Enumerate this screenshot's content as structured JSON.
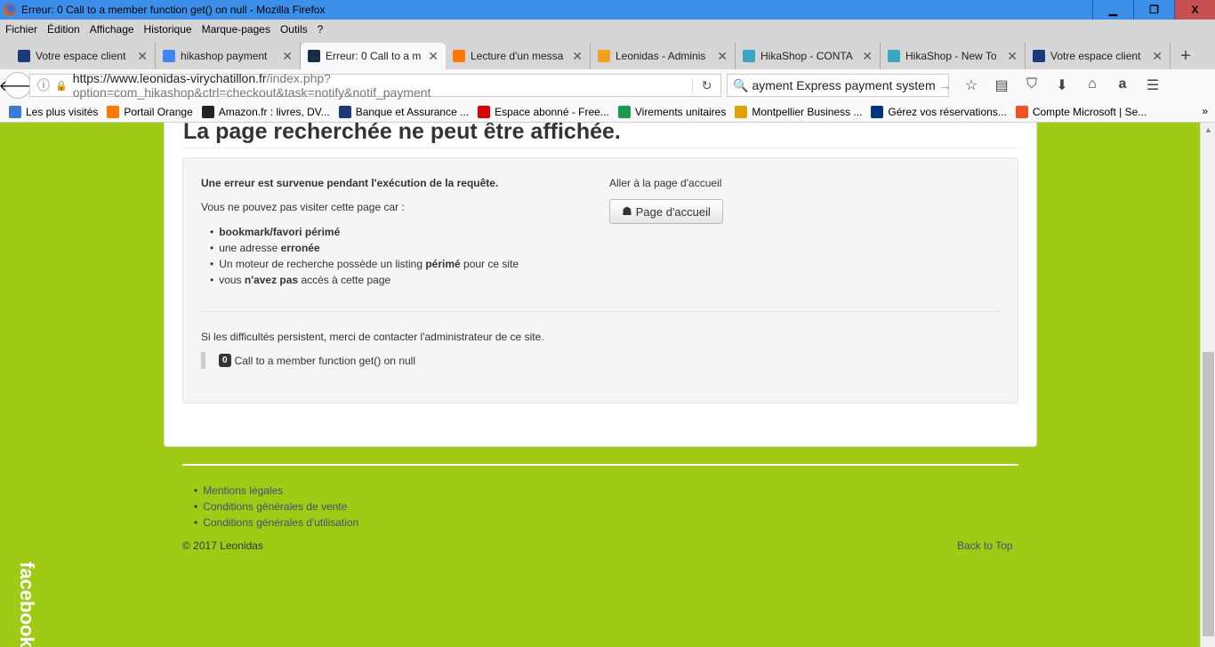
{
  "window": {
    "title": "Erreur: 0 Call to a member function get() on null - Mozilla Firefox",
    "min": "▁",
    "restore": "❐",
    "close": "X"
  },
  "menu": [
    "Fichier",
    "Édition",
    "Affichage",
    "Historique",
    "Marque-pages",
    "Outils",
    "?"
  ],
  "tabs": [
    {
      "label": "Votre espace client",
      "color": "#1a3a7a"
    },
    {
      "label": "hikashop payment",
      "color": "#4285f4"
    },
    {
      "label": "Erreur: 0 Call to a m",
      "color": "#1c2a4a",
      "active": true
    },
    {
      "label": "Lecture d'un messa",
      "color": "#ff7900"
    },
    {
      "label": "Leonidas - Adminis",
      "color": "#f4a020"
    },
    {
      "label": "HikaShop - CONTA",
      "color": "#3aa6c0"
    },
    {
      "label": "HikaShop - New To",
      "color": "#3aa6c0"
    },
    {
      "label": "Votre espace client",
      "color": "#1a3a7a"
    }
  ],
  "new_tab": "+",
  "address": {
    "domain": "https://www.leonidas-virychatillon.fr",
    "path": "/index.php?option=com_hikashop&ctrl=checkout&task=notify&notif_payment",
    "reload": "↻"
  },
  "search": {
    "value": "ayment Express payment system",
    "go": "→"
  },
  "bookmarks": [
    {
      "label": "Les plus visités",
      "color": "#3b7bd6"
    },
    {
      "label": "Portail Orange",
      "color": "#ff7900"
    },
    {
      "label": "Amazon.fr : livres, DV...",
      "color": "#222"
    },
    {
      "label": "Banque et Assurance ...",
      "color": "#1c3a7a"
    },
    {
      "label": "Espace abonné - Free...",
      "color": "#d00"
    },
    {
      "label": "Virements unitaires",
      "color": "#1a9a4a"
    },
    {
      "label": "Montpellier Business ...",
      "color": "#e0a000"
    },
    {
      "label": "Gérez vos réservations...",
      "color": "#003580"
    },
    {
      "label": "Compte Microsoft | Se...",
      "color": "#f25022"
    }
  ],
  "page": {
    "title": "La page recherchée ne peut être affichée.",
    "error_heading": "Une erreur est survenue pendant l'exécution de la requête.",
    "intro": "Vous ne pouvez pas visiter cette page car :",
    "reasons": [
      {
        "pre": "",
        "bold": "bookmark/favori périmé",
        "post": ""
      },
      {
        "pre": "une adresse ",
        "bold": "erronée",
        "post": ""
      },
      {
        "pre": "Un moteur de recherche possède un listing ",
        "bold": "périmé",
        "post": " pour ce site"
      },
      {
        "pre": "vous ",
        "bold": "n'avez pas",
        "post": " accès à cette page"
      }
    ],
    "home_label": "Aller à la page d'accueil",
    "home_button": "Page d'accueil",
    "contact": "Si les difficultés persistent, merci de contacter l'administrateur de ce site.",
    "error_code": "0",
    "error_message": "Call to a member function get() on null"
  },
  "footer": {
    "links": [
      "Mentions légales",
      "Conditions générales de vente",
      "Conditions générales d'utilisation"
    ],
    "copyright": "© 2017 Leonidas",
    "back_to_top": "Back to Top"
  },
  "facebook": "facebook"
}
